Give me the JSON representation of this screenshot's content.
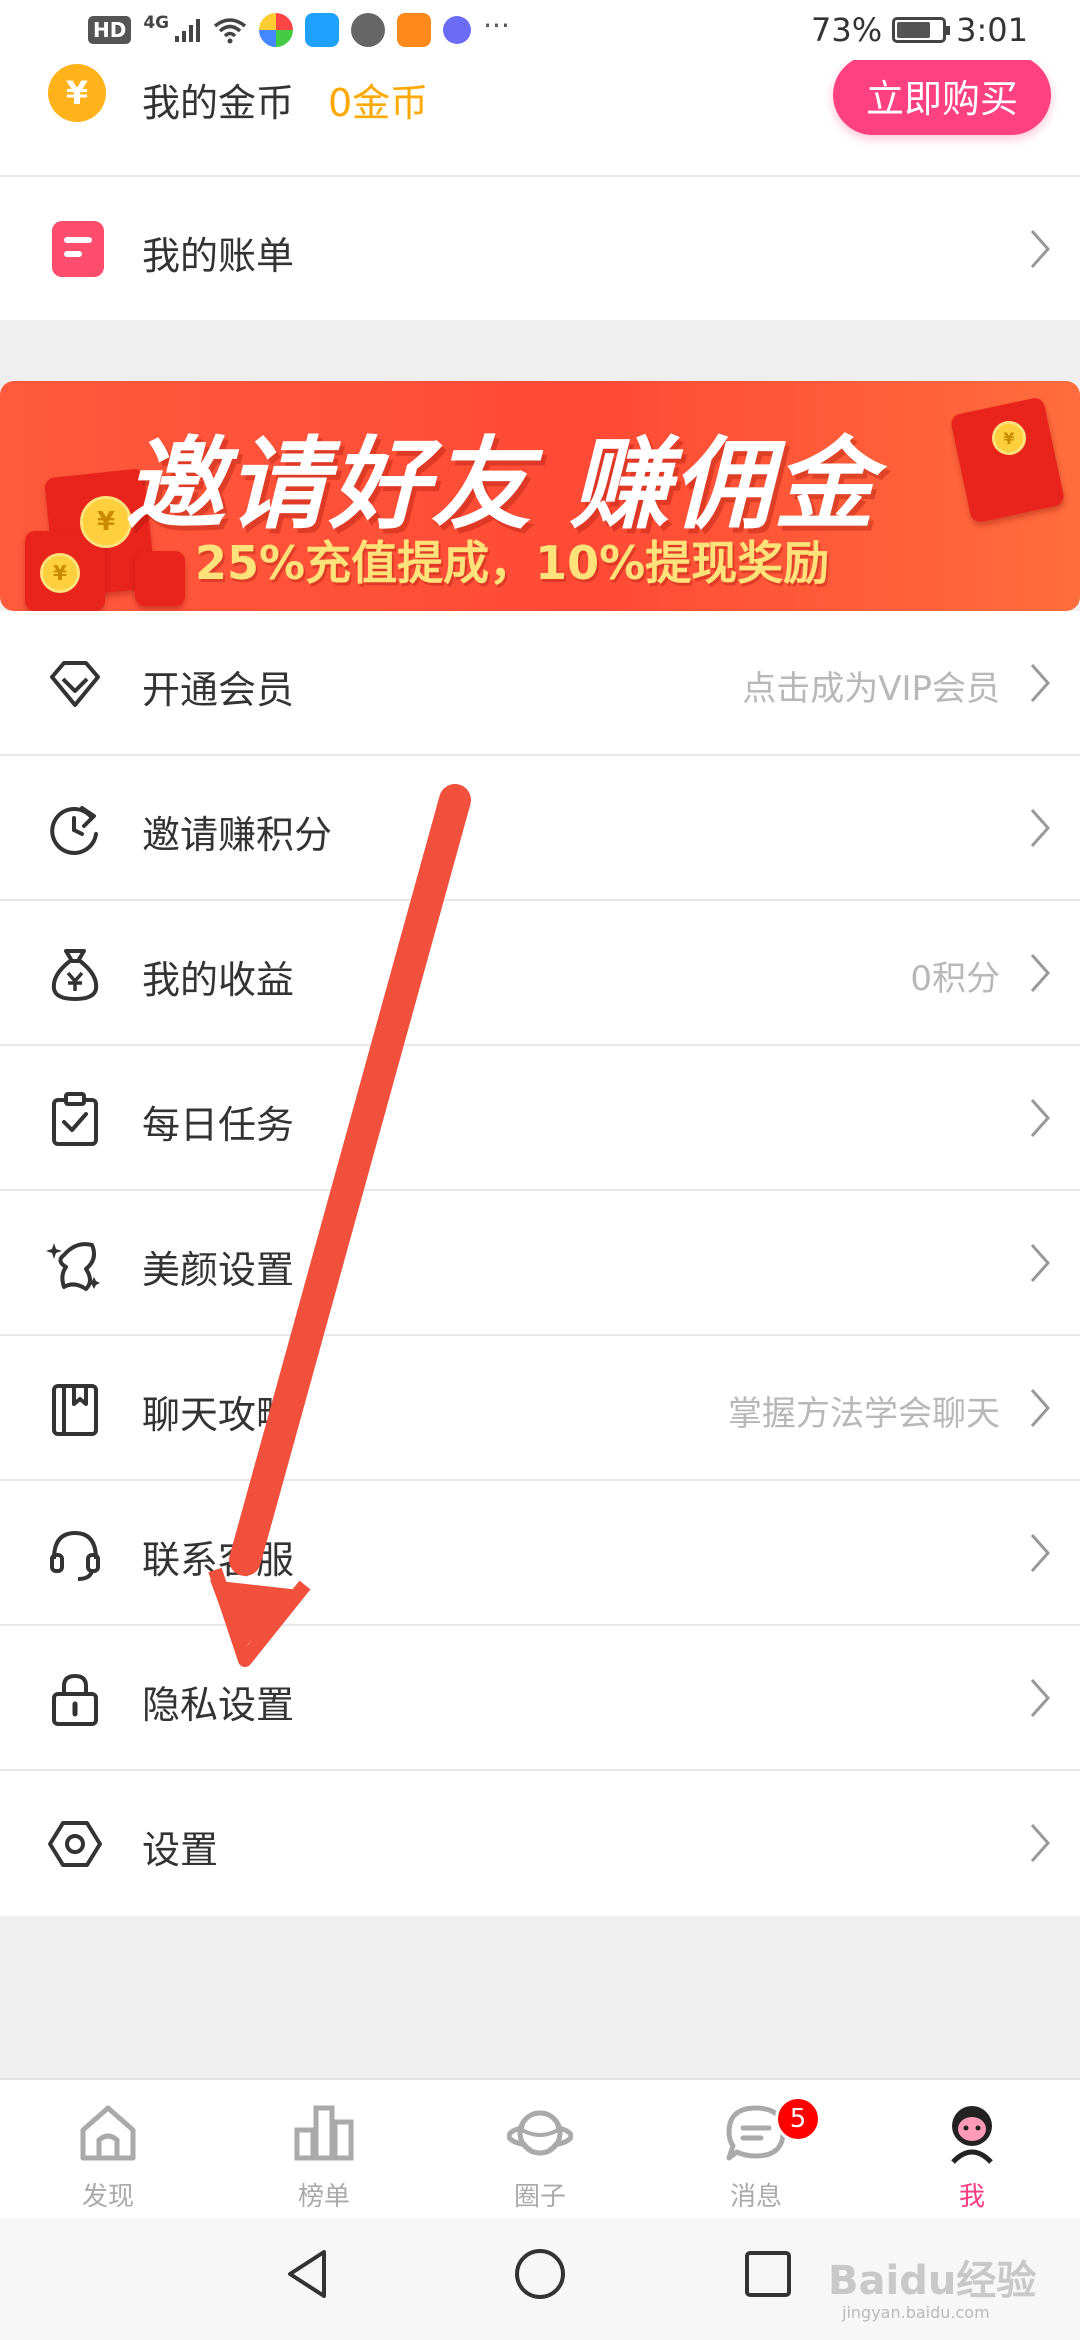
{
  "status_bar": {
    "hd": "HD",
    "network": "4G",
    "more": "···",
    "battery": "73%",
    "time": "3:01"
  },
  "coins": {
    "icon": "yen-coin-icon",
    "icon_glyph": "¥",
    "label": "我的金币",
    "value": "0金币",
    "buy_button": "立即购买"
  },
  "bill": {
    "label": "我的账单",
    "icon": "bill-icon"
  },
  "banner": {
    "title": "邀请好友  赚佣金",
    "subtitle": "25%充值提成，10%提现奖励",
    "coin_glyph": "¥"
  },
  "menu": [
    {
      "label": "开通会员",
      "hint": "点击成为VIP会员",
      "icon": "diamond-icon"
    },
    {
      "label": "邀请赚积分",
      "hint": "",
      "icon": "refresh-icon"
    },
    {
      "label": "我的收益",
      "hint": "0积分",
      "icon": "money-bag-icon"
    },
    {
      "label": "每日任务",
      "hint": "",
      "icon": "clipboard-check-icon"
    },
    {
      "label": "美颜设置",
      "hint": "",
      "icon": "sparkle-icon"
    },
    {
      "label": "聊天攻略",
      "hint": "掌握方法学会聊天",
      "icon": "book-icon"
    },
    {
      "label": "联系客服",
      "hint": "",
      "icon": "headset-icon"
    },
    {
      "label": "隐私设置",
      "hint": "",
      "icon": "lock-icon"
    },
    {
      "label": "设置",
      "hint": "",
      "icon": "settings-hexagon-icon"
    }
  ],
  "tabs": [
    {
      "label": "发现",
      "icon": "home-icon",
      "active": false
    },
    {
      "label": "榜单",
      "icon": "ranking-icon",
      "active": false
    },
    {
      "label": "圈子",
      "icon": "planet-icon",
      "active": false
    },
    {
      "label": "消息",
      "icon": "message-icon",
      "active": false,
      "badge": "5"
    },
    {
      "label": "我",
      "icon": "profile-icon",
      "active": true
    }
  ],
  "watermark": {
    "text": "Baidu经验",
    "sub": "jingyan.baidu.com"
  },
  "colors": {
    "accent": "#ff4081",
    "coin": "#ffa800",
    "banner": "#ff4a35",
    "annotation_arrow": "#f0503c",
    "badge": "#ff0000"
  }
}
